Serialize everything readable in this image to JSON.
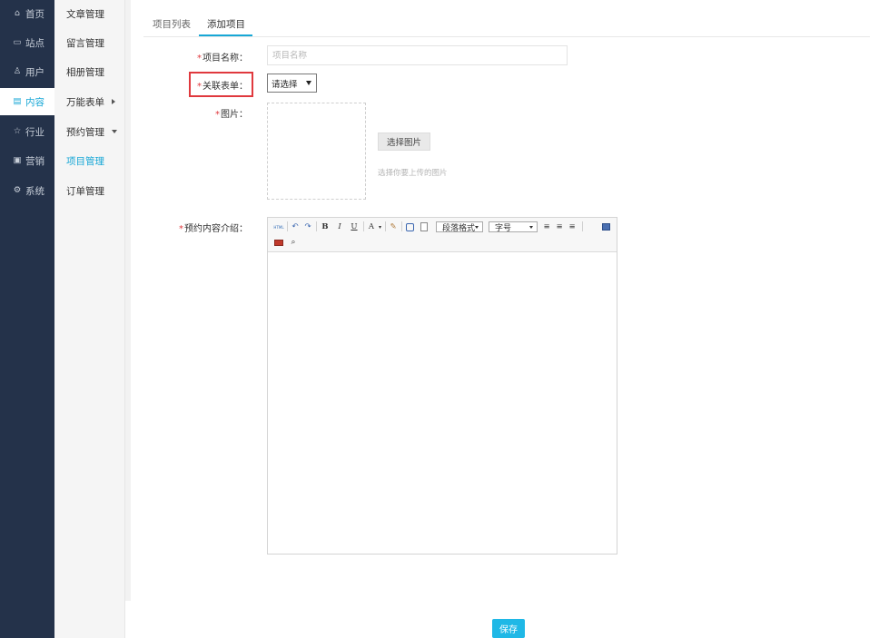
{
  "nav_primary": [
    {
      "icon": "home-icon",
      "glyph": "⌂",
      "label": "首页"
    },
    {
      "icon": "monitor-icon",
      "glyph": "▭",
      "label": "站点"
    },
    {
      "icon": "user-icon",
      "glyph": "♙",
      "label": "用户"
    },
    {
      "icon": "content-icon",
      "glyph": "▤",
      "label": "内容",
      "active": true
    },
    {
      "icon": "star-icon",
      "glyph": "☆",
      "label": "行业"
    },
    {
      "icon": "marketing-icon",
      "glyph": "▣",
      "label": "营销"
    },
    {
      "icon": "gear-icon",
      "glyph": "⚙",
      "label": "系统"
    }
  ],
  "nav_secondary": [
    {
      "label": "文章管理"
    },
    {
      "label": "留言管理"
    },
    {
      "label": "相册管理"
    },
    {
      "label": "万能表单",
      "caret": "right"
    },
    {
      "label": "预约管理",
      "caret": "down"
    },
    {
      "label": "项目管理",
      "active": true
    },
    {
      "label": "订单管理"
    }
  ],
  "tabs": {
    "list": "项目列表",
    "add": "添加项目"
  },
  "form": {
    "required_mark": "*",
    "name_label": "项目名称：",
    "name_placeholder": "项目名称",
    "name_value": "",
    "related_form_label": "关联表单：",
    "related_form_selected": "请选择",
    "image_label": "图片：",
    "choose_image_button": "选择图片",
    "image_hint": "选择你要上传的图片",
    "intro_label": "预约内容介绍："
  },
  "editor": {
    "html_button": "HTML",
    "undo_glyph": "↶",
    "redo_glyph": "↷",
    "bold_glyph": "B",
    "italic_glyph": "I",
    "underline_glyph": "U",
    "font_color_glyph": "A",
    "paragraph_format": "段落格式",
    "font_size": "字号"
  },
  "save_button": "保存",
  "colors": {
    "accent": "#17a7d6",
    "save_button": "#1fb8e6",
    "nav_dark": "#24324a",
    "highlight_box": "#e0393e"
  }
}
